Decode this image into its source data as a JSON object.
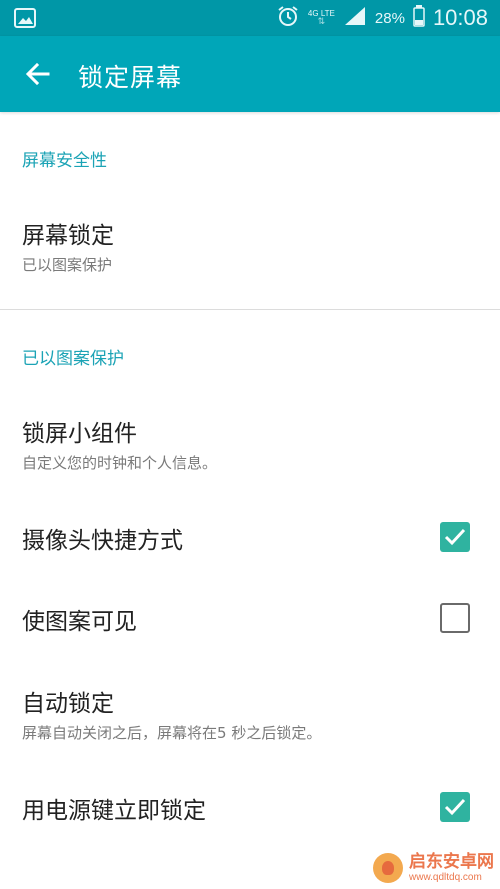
{
  "status_bar": {
    "network_type": "4G LTE",
    "battery": "28%",
    "time": "10:08",
    "icons": [
      "gallery-icon",
      "alarm-icon",
      "data-arrows-icon",
      "signal-icon",
      "battery-icon"
    ]
  },
  "app_bar": {
    "title": "锁定屏幕",
    "back_icon": "arrow-left-icon",
    "background": "#00a6b8"
  },
  "sections": [
    {
      "header": "屏幕安全性",
      "items": [
        {
          "title": "屏幕锁定",
          "subtitle": "已以图案保护"
        }
      ]
    },
    {
      "header": "已以图案保护",
      "items": [
        {
          "title": "锁屏小组件",
          "subtitle": "自定义您的时钟和个人信息。"
        },
        {
          "title": "摄像头快捷方式",
          "checked": true
        },
        {
          "title": "使图案可见",
          "checked": false
        },
        {
          "title": "自动锁定",
          "subtitle": "屏幕自动关闭之后，屏幕将在5 秒之后锁定。"
        },
        {
          "title": "用电源键立即锁定",
          "checked": true
        }
      ]
    }
  ],
  "watermark": {
    "name": "启东安卓网",
    "url": "www.qdltdq.com"
  },
  "colors": {
    "accent": "#1ba3b5",
    "checkbox_on": "#2fb3a0",
    "status_bar": "#0097a7"
  }
}
